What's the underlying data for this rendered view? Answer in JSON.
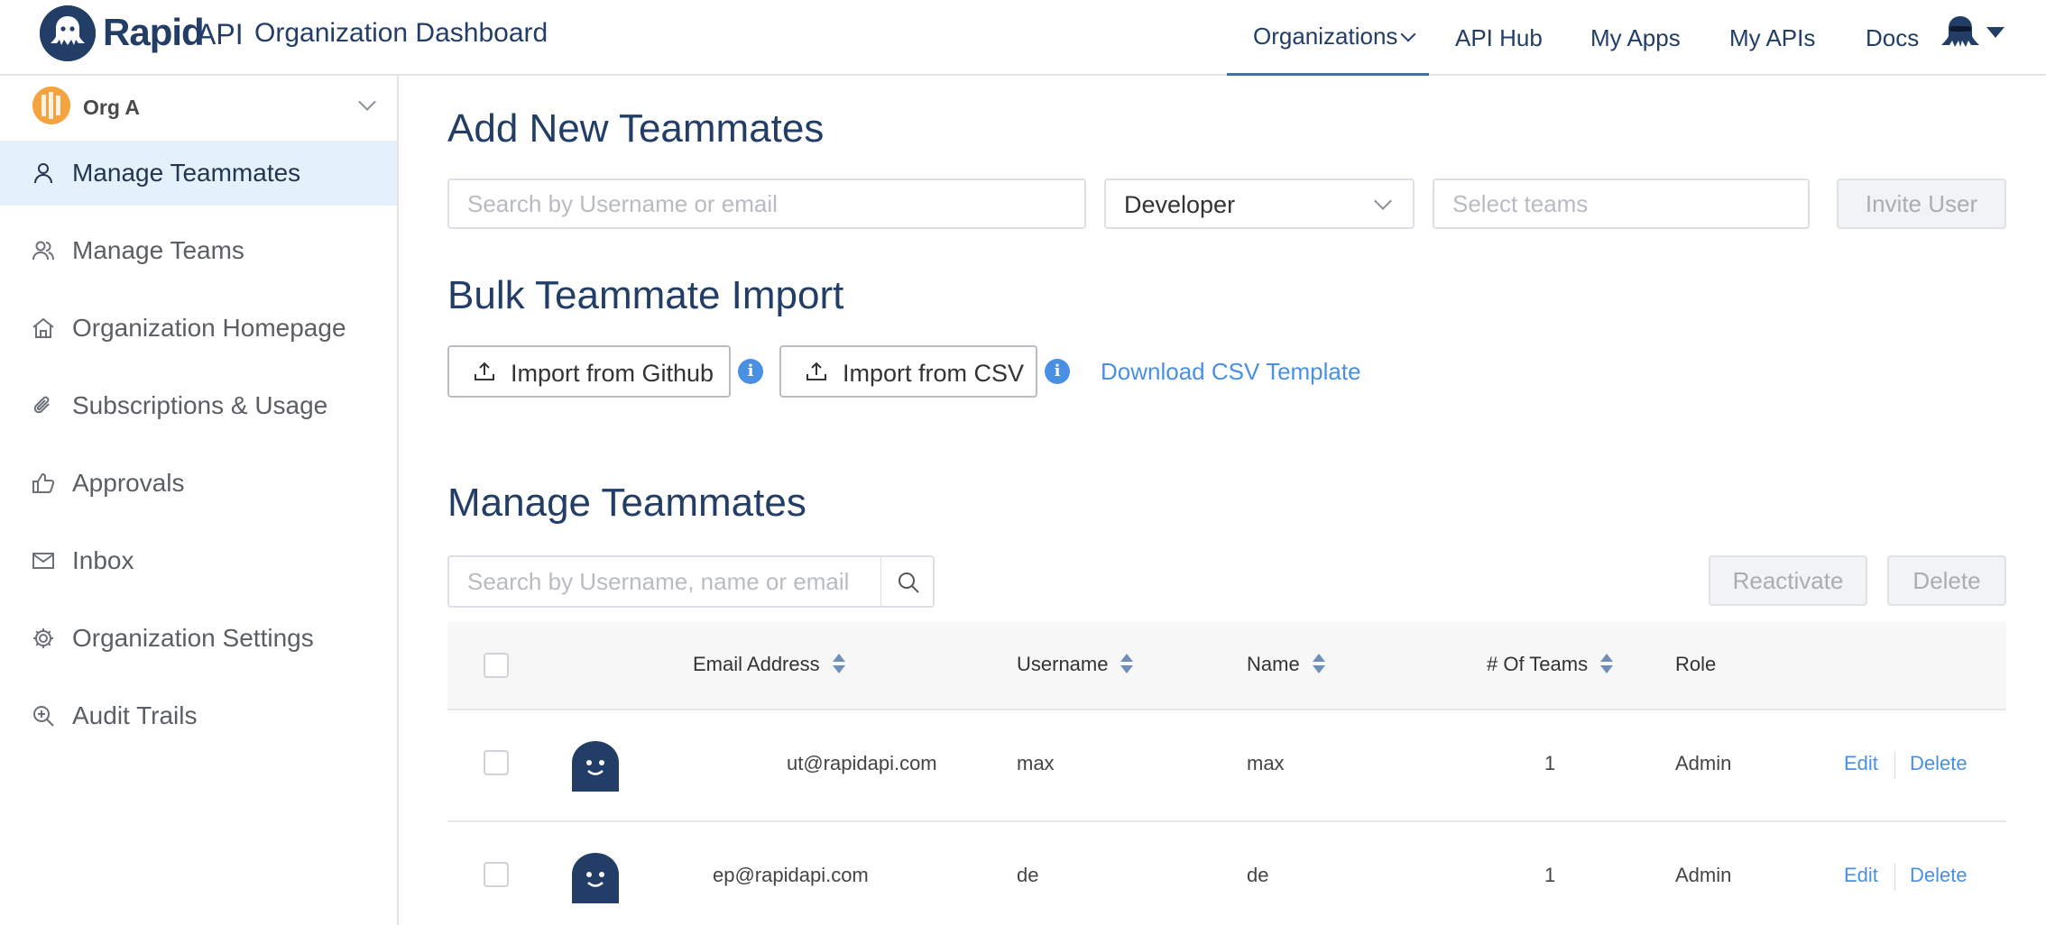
{
  "header": {
    "brand": "Rapid",
    "brand_suffix": "API",
    "title": "Organization Dashboard",
    "nav": [
      {
        "label": "Organizations"
      },
      {
        "label": "API Hub"
      },
      {
        "label": "My Apps"
      },
      {
        "label": "My APIs"
      },
      {
        "label": "Docs"
      }
    ],
    "active_nav": "Organizations"
  },
  "sidebar": {
    "org_name": "Org A",
    "items": [
      {
        "label": "Manage Teammates",
        "icon": "user-icon"
      },
      {
        "label": "Manage Teams",
        "icon": "users-icon"
      },
      {
        "label": "Organization Homepage",
        "icon": "home-icon"
      },
      {
        "label": "Subscriptions & Usage",
        "icon": "paperclip-icon"
      },
      {
        "label": "Approvals",
        "icon": "thumbs-up-icon"
      },
      {
        "label": "Inbox",
        "icon": "mail-icon"
      },
      {
        "label": "Organization Settings",
        "icon": "gear-icon"
      },
      {
        "label": "Audit Trails",
        "icon": "zoom-in-icon"
      }
    ],
    "active_item": "Manage Teammates"
  },
  "add_section": {
    "title": "Add New Teammates",
    "search_placeholder": "Search by Username or email",
    "role_value": "Developer",
    "teams_placeholder": "Select teams",
    "invite_label": "Invite User"
  },
  "bulk_section": {
    "title": "Bulk Teammate Import",
    "github_label": "Import from Github",
    "csv_label": "Import from CSV",
    "info_glyph": "i",
    "template_link": "Download CSV Template"
  },
  "manage_section": {
    "title": "Manage Teammates",
    "search_placeholder": "Search by Username, name or email",
    "reactivate_label": "Reactivate",
    "delete_label": "Delete"
  },
  "table": {
    "columns": {
      "email": "Email Address",
      "username": "Username",
      "name": "Name",
      "teams": "# Of Teams",
      "role": "Role"
    },
    "rows": [
      {
        "email": "ut@rapidapi.com",
        "username": "max",
        "name": "max",
        "teams": "1",
        "role": "Admin",
        "edit": "Edit",
        "delete": "Delete"
      },
      {
        "email": "ep@rapidapi.com",
        "username": "de",
        "name": "de",
        "teams": "1",
        "role": "Admin",
        "edit": "Edit",
        "delete": "Delete"
      }
    ]
  },
  "colors": {
    "brand_navy": "#233e66",
    "link_blue": "#4a90e2",
    "active_bg": "#e4f1fb",
    "org_logo": "#f5a340"
  }
}
